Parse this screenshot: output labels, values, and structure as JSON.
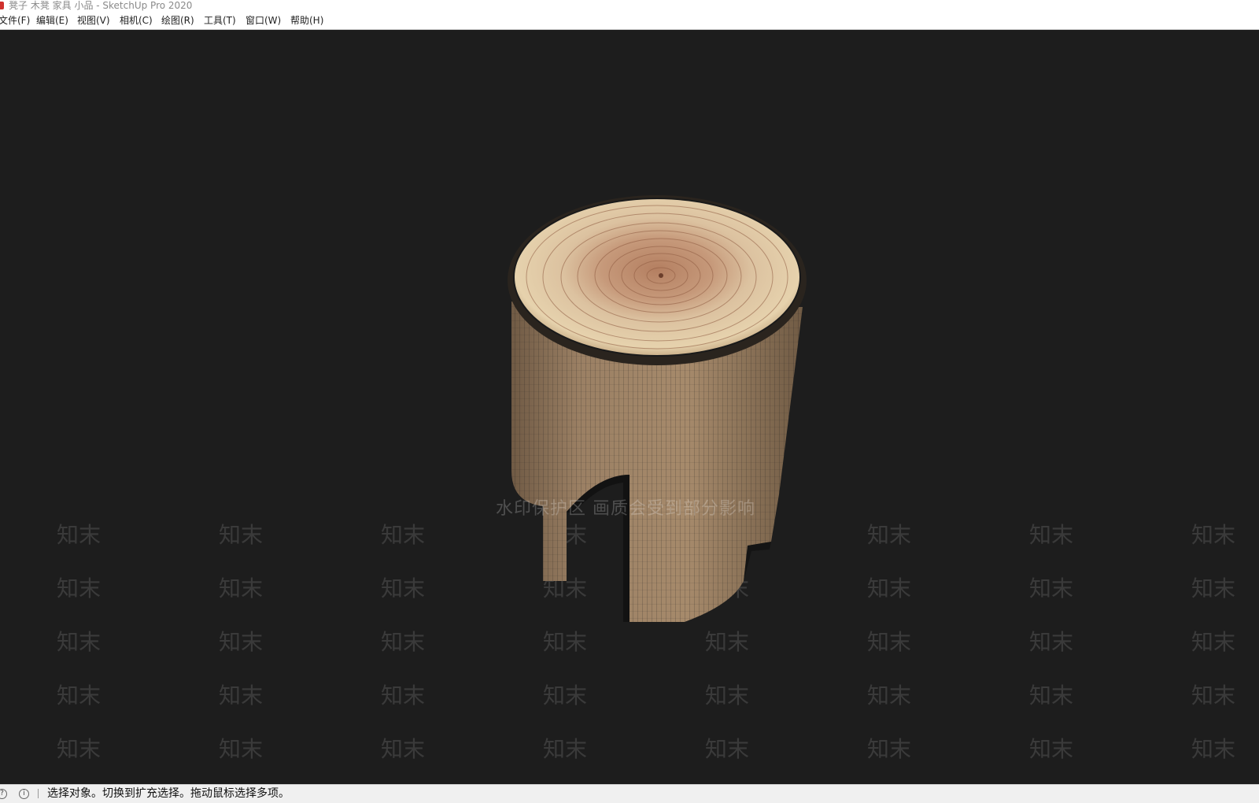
{
  "window": {
    "title": "凳子 木凳 家具 小品 - SketchUp Pro 2020"
  },
  "menu": [
    {
      "label": "文件(F)"
    },
    {
      "label": "编辑(E)"
    },
    {
      "label": "视图(V)"
    },
    {
      "label": "相机(C)"
    },
    {
      "label": "绘图(R)"
    },
    {
      "label": "工具(T)"
    },
    {
      "label": "窗口(W)"
    },
    {
      "label": "帮助(H)"
    }
  ],
  "viewport": {
    "background_color": "#1d1d1d",
    "model": "wooden-stump-stool",
    "watermark": {
      "banner_text": "水印保护区  画质会受到部分影响",
      "tile_text": "知末"
    }
  },
  "statusbar": {
    "message": "选择对象。切换到扩充选择。拖动鼠标选择多项。"
  },
  "colors": {
    "wood_top_light": "#e2c9a2",
    "wood_top_dark": "#b78463",
    "wood_side": "#8d7358",
    "wireframe": "#1b1b1b"
  }
}
